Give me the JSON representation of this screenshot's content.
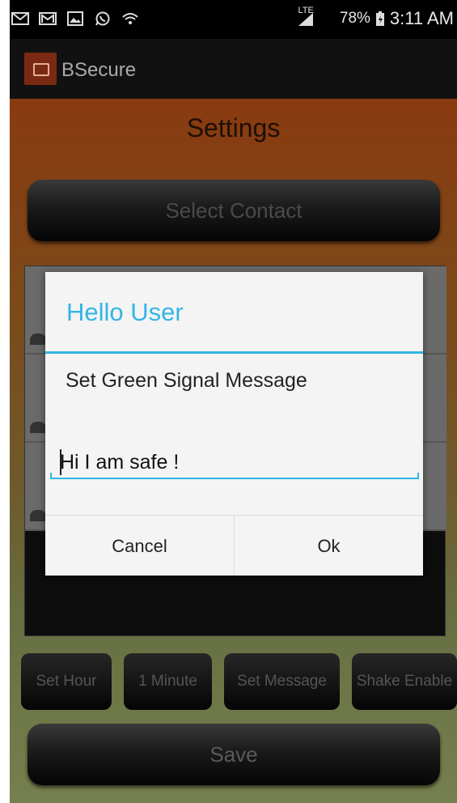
{
  "status_bar": {
    "icons": [
      "mail-icon",
      "gmail-icon",
      "image-icon",
      "whatsapp-icon",
      "wifi-icon"
    ],
    "network": "LTE",
    "battery": "78%",
    "time": "3:11 AM"
  },
  "action_bar": {
    "title": "BSecure"
  },
  "settings": {
    "heading": "Settings",
    "select_contact": "Select Contact",
    "small_buttons": [
      "Set Hour",
      "1 Minute",
      "Set Message",
      "Shake Enable"
    ],
    "save": "Save"
  },
  "dialog": {
    "title": "Hello User",
    "message": "Set Green Signal Message",
    "input_value": "Hi I am safe !",
    "cancel": "Cancel",
    "ok": "Ok"
  },
  "colors": {
    "accent": "#33b5e5",
    "brand": "#7a2a12"
  }
}
